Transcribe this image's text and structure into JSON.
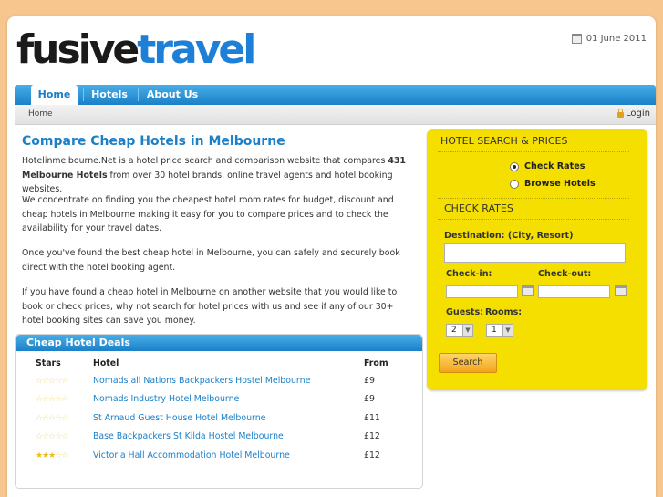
{
  "logo": {
    "part1": "fusive",
    "part2": "travel"
  },
  "date": "01 June 2011",
  "nav": {
    "items": [
      "Home",
      "Hotels",
      "About Us"
    ]
  },
  "breadcrumb": "Home",
  "login": "Login",
  "main": {
    "title": "Compare Cheap Hotels in Melbourne",
    "p1_a": "Hotelinmelbourne.Net is a hotel price search and comparison website that compares ",
    "p1_b": "431 Melbourne Hotels",
    "p1_c": " from over 30 hotel brands, online travel agents and hotel booking websites.",
    "p2": "We concentrate on finding you the cheapest hotel room rates for budget, discount and cheap hotels in Melbourne making it easy for you to compare prices and to check the availability for your travel dates.",
    "p3": "Once you've found the best cheap hotel in Melbourne, you can safely and securely book direct with the hotel booking agent.",
    "p4": "If you have found a cheap hotel in Melbourne on another website that you would like to book or check prices, why not search for hotel prices with us and see if any of our 30+ hotel booking sites can save you money."
  },
  "deals": {
    "title": "Cheap Hotel Deals",
    "columns": [
      "Stars",
      "Hotel",
      "From"
    ],
    "rows": [
      {
        "stars": 0,
        "hotel": "Nomads all Nations Backpackers Hostel Melbourne",
        "price": "£9"
      },
      {
        "stars": 0,
        "hotel": "Nomads Industry Hotel Melbourne",
        "price": "£9"
      },
      {
        "stars": 0,
        "hotel": "St Arnaud Guest House Hotel Melbourne",
        "price": "£11"
      },
      {
        "stars": 0,
        "hotel": "Base Backpackers St Kilda Hostel Melbourne",
        "price": "£12"
      },
      {
        "stars": 3,
        "hotel": "Victoria Hall Accommodation Hotel Melbourne",
        "price": "£12"
      }
    ]
  },
  "search": {
    "title": "HOTEL SEARCH & PRICES",
    "opt_check": "Check Rates",
    "opt_browse": "Browse Hotels",
    "check_title": "CHECK RATES",
    "dest_label": "Destination: (City, Resort)",
    "checkin_label": "Check-in:",
    "checkout_label": "Check-out:",
    "guests_label": "Guests:",
    "rooms_label": "Rooms:",
    "guests_value": "2",
    "rooms_value": "1",
    "button": "Search"
  },
  "colors": {
    "accent": "#1b80c8",
    "panel": "#f5df00",
    "background": "#f7c68e"
  }
}
